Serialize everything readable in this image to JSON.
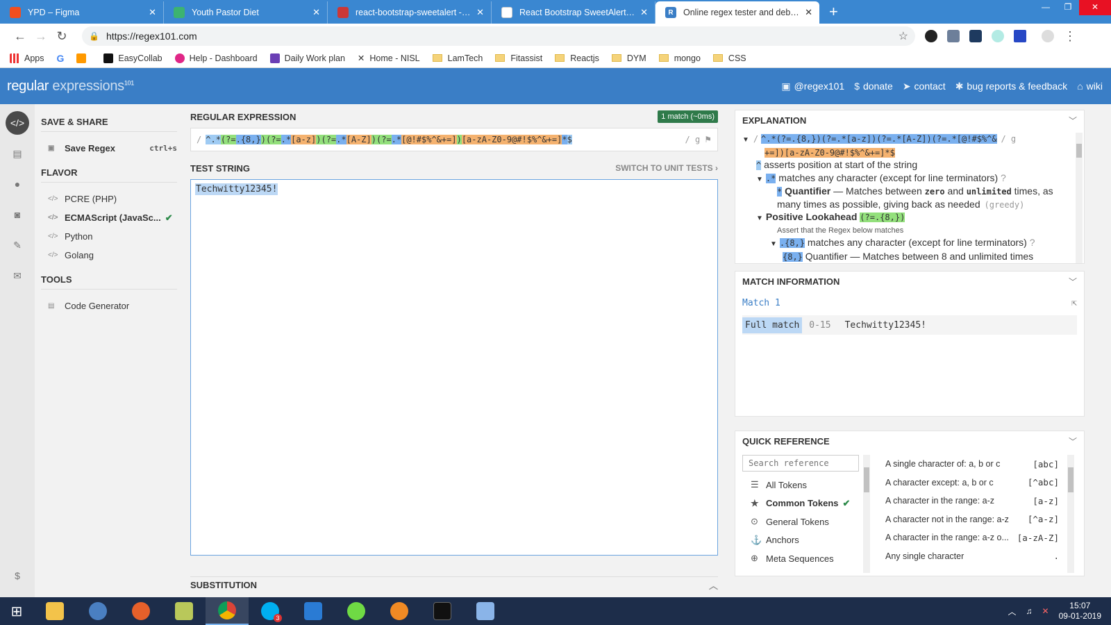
{
  "browser": {
    "tabs": [
      {
        "title": "YPD – Figma",
        "color": "#f24e1e"
      },
      {
        "title": "Youth Pastor Diet",
        "color": "#3cb371"
      },
      {
        "title": "react-bootstrap-sweetalert - npm",
        "color": "#cb3837"
      },
      {
        "title": "React Bootstrap SweetAlert Dem",
        "color": "#888888"
      },
      {
        "title": "Online regex tester and debugge",
        "color": "#3a7ec6",
        "favicon_letter": "R"
      }
    ],
    "new_tab": "+",
    "url": "https://regex101.com",
    "bookmarks": [
      "Apps",
      "EasyCollab",
      "Help - Dashboard",
      "Daily Work plan",
      "Home - NISL",
      "LamTech",
      "Fitassist",
      "Reactjs",
      "DYM",
      "mongo",
      "CSS"
    ]
  },
  "header": {
    "logo_main": "regular",
    "logo_ex": "expressions",
    "logo_sup": "101",
    "links": [
      "@regex101",
      "donate",
      "contact",
      "bug reports & feedback",
      "wiki"
    ]
  },
  "sidebar": {
    "save_title": "SAVE & SHARE",
    "save_label": "Save Regex",
    "save_kbd": "ctrl+s",
    "flavor_title": "FLAVOR",
    "flavors": [
      "PCRE (PHP)",
      "ECMAScript (JavaSc...",
      "Python",
      "Golang"
    ],
    "selected_flavor": "ECMAScript (JavaSc...",
    "tools_title": "TOOLS",
    "tool": "Code Generator"
  },
  "editor": {
    "regex_title": "REGULAR EXPRESSION",
    "match_badge": "1 match (~0ms)",
    "delim": "/",
    "flags": "/ g",
    "regex_tokens": [
      {
        "t": "^",
        "c": "t-a"
      },
      {
        "t": ".*",
        "c": "t-a"
      },
      {
        "t": "(?=",
        "c": "t-g"
      },
      {
        "t": ".{8,}",
        "c": "t-b"
      },
      {
        "t": ")",
        "c": "t-g"
      },
      {
        "t": "(?=",
        "c": "t-g"
      },
      {
        "t": ".*",
        "c": "t-b"
      },
      {
        "t": "[a-z]",
        "c": "t-o"
      },
      {
        "t": ")",
        "c": "t-g"
      },
      {
        "t": "(?=",
        "c": "t-g"
      },
      {
        "t": ".*",
        "c": "t-b"
      },
      {
        "t": "[A-Z]",
        "c": "t-o"
      },
      {
        "t": ")",
        "c": "t-g"
      },
      {
        "t": "(?=",
        "c": "t-g"
      },
      {
        "t": ".*",
        "c": "t-b"
      },
      {
        "t": "[@!#$%^&+=]",
        "c": "t-o"
      },
      {
        "t": ")",
        "c": "t-g"
      },
      {
        "t": "[a-zA-Z0-9@#!$%^&+=]",
        "c": "t-o"
      },
      {
        "t": "*",
        "c": "t-b"
      },
      {
        "t": "$",
        "c": "t-a"
      }
    ],
    "test_title": "TEST STRING",
    "switch_label": "SWITCH TO UNIT TESTS",
    "test_string": "Techwitty12345!",
    "subst_title": "SUBSTITUTION"
  },
  "explanation": {
    "title": "EXPLANATION",
    "line1": "^.*(?=.{8,})(?=.*[a-z])(?=.*[A-Z])(?=.*[@!#$%^&",
    "line2": "+=])[a-zA-Z0-9@#!$%^&+=]*$",
    "flags": "/ g",
    "anchor_tok": "^",
    "anchor_text": "asserts position at start of the string",
    "dot_tok": ".*",
    "dot_text": "matches any character (except for line terminators)",
    "quant_tok": "*",
    "quant_label": "Quantifier",
    "quant_text_a": "— Matches between",
    "zero": "zero",
    "and": "and",
    "unlimited": "unlimited",
    "quant_text_b": "times, as",
    "quant_text_c": "many times as possible, giving back as needed",
    "greedy": "(greedy)",
    "look_label": "Positive Lookahead",
    "look_tok": "(?=.{8,})",
    "assert_text": "Assert that the Regex below matches",
    "dot8_tok": ".{8,}",
    "dot8_text": "matches any character (except for line terminators)",
    "cut_tok": "{8,}",
    "cut_text": "Quantifier — Matches between 8 and unlimited times"
  },
  "match_info": {
    "title": "MATCH INFORMATION",
    "match_label": "Match 1",
    "full_match": "Full match",
    "range": "0-15",
    "value": "Techwitty12345!"
  },
  "quick_ref": {
    "title": "QUICK REFERENCE",
    "search_placeholder": "Search reference",
    "categories": [
      "All Tokens",
      "Common Tokens",
      "General Tokens",
      "Anchors",
      "Meta Sequences"
    ],
    "selected": "Common Tokens",
    "items": [
      {
        "desc": "A single character of: a, b or c",
        "tok": "[abc]"
      },
      {
        "desc": "A character except: a, b or c",
        "tok": "[^abc]"
      },
      {
        "desc": "A character in the range: a-z",
        "tok": "[a-z]"
      },
      {
        "desc": "A character not in the range: a-z",
        "tok": "[^a-z]"
      },
      {
        "desc": "A character in the range: a-z o...",
        "tok": "[a-zA-Z]"
      },
      {
        "desc": "Any single character",
        "tok": "."
      }
    ]
  },
  "taskbar": {
    "time": "15:07",
    "date": "09-01-2019",
    "skype_badge": "3"
  }
}
